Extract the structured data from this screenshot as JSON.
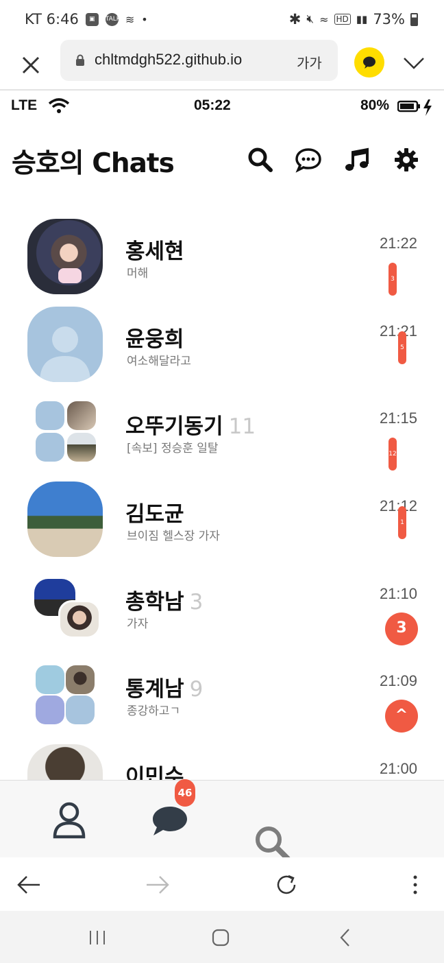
{
  "status_bar": {
    "carrier_time": "KT 6:46",
    "battery": "73%",
    "icons": [
      "gallery-icon",
      "talk-icon",
      "wind-icon",
      "bluetooth-icon",
      "mute-icon",
      "wifi-icon",
      "hd-icon",
      "signal-icon",
      "battery-icon"
    ]
  },
  "url_bar": {
    "url": "chltmdgh522.github.io",
    "text_size_label": "가가",
    "close": "close-icon",
    "menu": "chevron-down-icon"
  },
  "app_status": {
    "network": "LTE",
    "time": "05:22",
    "battery": "80%"
  },
  "header": {
    "title": "승호의 Chats",
    "icons": [
      "search-icon",
      "chat-bubble-icon",
      "music-icon",
      "gear-icon"
    ]
  },
  "chats": [
    {
      "name": "홍세현",
      "count": "",
      "message": "머해",
      "time": "21:22",
      "badge": "3",
      "badge_style": "small"
    },
    {
      "name": "윤웅희",
      "count": "",
      "message": "여소해달라고",
      "time": "21:21",
      "badge": "5",
      "badge_style": "small"
    },
    {
      "name": "오뚜기동기",
      "count": "11",
      "message": "[속보] 정승훈 일탈",
      "time": "21:15",
      "badge": "12",
      "badge_style": "small"
    },
    {
      "name": "김도균",
      "count": "",
      "message": "브이짐 헬스장 가자",
      "time": "21:12",
      "badge": "1",
      "badge_style": "small"
    },
    {
      "name": "총학남",
      "count": "3",
      "message": "가자",
      "time": "21:10",
      "badge": "3",
      "badge_style": "round"
    },
    {
      "name": "통계남",
      "count": "9",
      "message": "종강하고ㄱ",
      "time": "21:09",
      "badge": "^",
      "badge_style": "round"
    },
    {
      "name": "이민수",
      "count": "",
      "message": "",
      "time": "21:00",
      "badge": "",
      "badge_style": ""
    }
  ],
  "bottom_nav": {
    "chat_badge": "46"
  },
  "colors": {
    "badge": "#f05a43",
    "kakao_yellow": "#ffdd00",
    "avatar_placeholder": "#a7c4de"
  }
}
